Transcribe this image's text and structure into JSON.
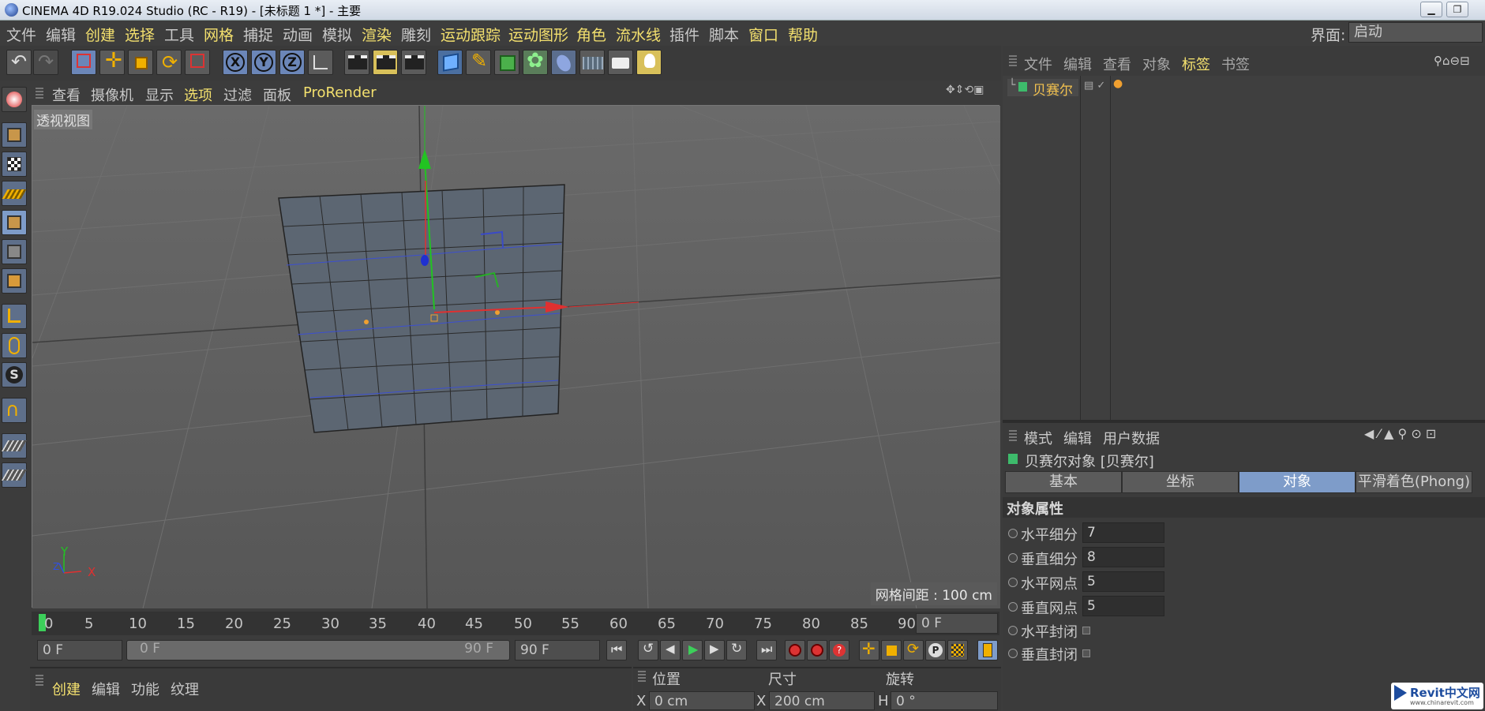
{
  "window": {
    "title": "CINEMA 4D R19.024 Studio (RC - R19) - [未标题 1 *] - 主要"
  },
  "menubar": {
    "items": [
      "文件",
      "编辑",
      "创建",
      "选择",
      "工具",
      "网格",
      "捕捉",
      "动画",
      "模拟",
      "渲染",
      "雕刻",
      "运动跟踪",
      "运动图形",
      "角色",
      "流水线",
      "插件",
      "脚本",
      "窗口",
      "帮助"
    ],
    "interface_label": "界面:",
    "interface_value": "启动"
  },
  "viewport": {
    "menu": [
      "查看",
      "摄像机",
      "显示",
      "选项",
      "过滤",
      "面板",
      "ProRender"
    ],
    "view_label": "透视视图",
    "grid_spacing": "网格间距 : 100 cm"
  },
  "object_manager": {
    "menu": [
      "文件",
      "编辑",
      "查看",
      "对象",
      "标签",
      "书签"
    ],
    "object_name": "贝赛尔"
  },
  "attribute_manager": {
    "menu": [
      "模式",
      "编辑",
      "用户数据"
    ],
    "object_title": "贝赛尔对象 [贝赛尔]",
    "tabs": [
      "基本",
      "坐标",
      "对象",
      "平滑着色(Phong)"
    ],
    "section": "对象属性",
    "props": [
      {
        "label": "水平细分",
        "value": "7"
      },
      {
        "label": "垂直细分",
        "value": "8"
      },
      {
        "label": "水平网点",
        "value": "5"
      },
      {
        "label": "垂直网点",
        "value": "5"
      },
      {
        "label": "水平封闭",
        "value": ""
      },
      {
        "label": "垂直封闭",
        "value": ""
      }
    ]
  },
  "timeline": {
    "ticks": [
      "0",
      "5",
      "10",
      "15",
      "20",
      "25",
      "30",
      "35",
      "40",
      "45",
      "50",
      "55",
      "60",
      "65",
      "70",
      "75",
      "80",
      "85",
      "90"
    ],
    "current_frame": "0 F",
    "start_frame": "0 F",
    "range_start": "0 F",
    "range_end": "90 F",
    "end_frame": "90 F"
  },
  "material_manager": {
    "menu": [
      "创建",
      "编辑",
      "功能",
      "纹理"
    ]
  },
  "coordinates": {
    "headers": [
      "位置",
      "尺寸",
      "旋转"
    ],
    "x_label": "X",
    "x_pos": "0 cm",
    "x_size_label": "X",
    "x_size": "200 cm",
    "h_label": "H",
    "h_rot": "0 °"
  },
  "watermark": {
    "brand": "Revit中文网",
    "url": "www.chinarevit.com"
  },
  "colors": {
    "accent": "#f3e06e",
    "active_tab": "#7e9cc9",
    "panel": "#3b3b3b"
  }
}
